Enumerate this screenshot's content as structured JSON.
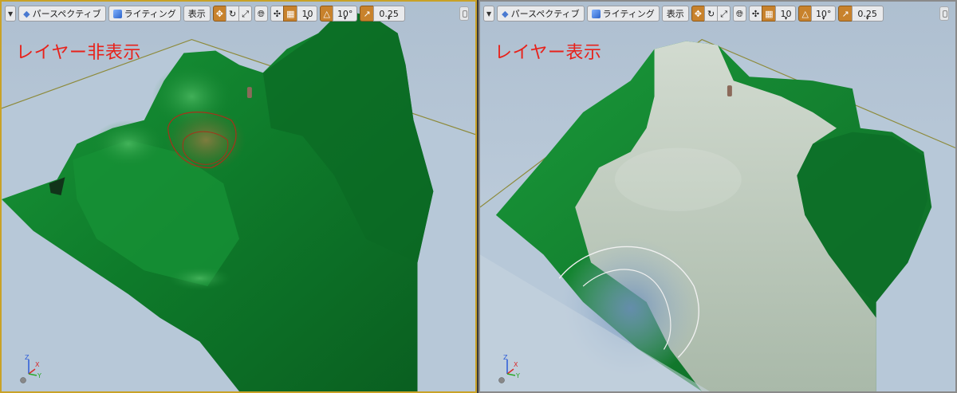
{
  "toolbar": {
    "perspective_label": "パースペクティブ",
    "lighting_label": "ライティング",
    "show_label": "表示",
    "grid_value": "10",
    "rotation_value": "10°",
    "scale_value": "0.25"
  },
  "viewports": {
    "left": {
      "caption": "レイヤー非表示"
    },
    "right": {
      "caption": "レイヤー表示"
    }
  },
  "axis": {
    "x": "X",
    "y": "Y",
    "z": "Z"
  },
  "colors": {
    "caption": "#e8211a",
    "selected_border": "#c9a227",
    "landscape_green": "#0f7d2b",
    "paint_layer": "#b9c4b6",
    "floor": "#b8c9d9"
  }
}
